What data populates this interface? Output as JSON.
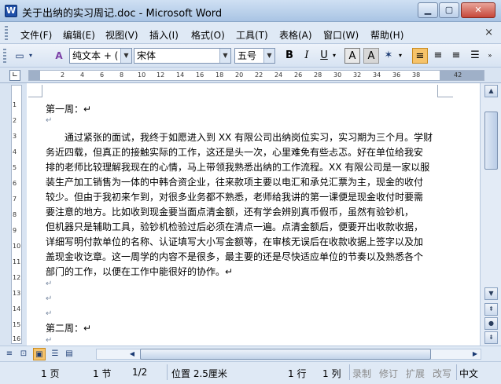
{
  "window": {
    "title": "关于出纳的实习周记.doc - Microsoft Word",
    "minimize": "▁",
    "maximize": "▢",
    "close": "✕"
  },
  "menu": {
    "items": [
      "文件(F)",
      "编辑(E)",
      "视图(V)",
      "插入(I)",
      "格式(O)",
      "工具(T)",
      "表格(A)",
      "窗口(W)",
      "帮助(H)"
    ],
    "close_doc": "×"
  },
  "toolbar": {
    "style_value": "纯文本 + (",
    "font_value": "宋体",
    "size_value": "五号",
    "bold": "B",
    "italic": "I",
    "underline": "U",
    "highlight": "A",
    "charborder": "A"
  },
  "ruler": {
    "ticks": [
      "2",
      "4",
      "6",
      "8",
      "10",
      "12",
      "14",
      "16",
      "18",
      "20",
      "22",
      "24",
      "26",
      "28",
      "30",
      "32",
      "34",
      "36",
      "38",
      "42"
    ],
    "vticks": [
      "1",
      "2",
      "3",
      "4",
      "5",
      "6",
      "7",
      "8",
      "9",
      "10",
      "11",
      "12",
      "13",
      "14",
      "15",
      "16"
    ]
  },
  "document": {
    "lines": [
      "第一周：↵",
      "↵",
      "　　通过紧张的面试，我终于如愿进入到 XX 有限公司出纳岗位实习，实习期为三个月。学财",
      "务近四载，但真正的接触实际的工作，这还是头一次，心里难免有些忐忑。好在单位给我安",
      "排的老师比较理解我现在的心情，马上带领我熟悉出纳的工作流程。XX 有限公司是一家以服",
      "装生产加工销售为一体的中韩合资企业，往来款项主要以电汇和承兑汇票为主，现金的收付",
      "较少。但由于我初来乍到，对很多业务都不熟悉，老师给我讲的第一课便是现金收付时要需",
      "要注意的地方。比如收到现金要当面点清金额，还有学会辨别真币假币，虽然有验钞机，",
      "但机器只是辅助工具，验钞机检验过后必须在清点一遍。点清金额后，便要开出收款收据，",
      "详细写明付款单位的名称、认证填写大小写金额等，在审核无误后在收款收据上签字以及加",
      "盖现金收讫章。这一周学的内容不是很多，最主要的还是尽快适应单位的节奏以及熟悉各个",
      "部门的工作，以便在工作中能很好的协作。↵",
      "↵",
      "↵",
      "↵",
      "第二周：↵",
      "↵"
    ]
  },
  "status": {
    "page": "1 页",
    "section": "1 节",
    "pages": "1/2",
    "position": "位置 2.5厘米",
    "line": "1 行",
    "column": "1 列",
    "rec": "录制",
    "trk": "修订",
    "ext": "扩展",
    "ovr": "改写",
    "language": "中文"
  },
  "icons": {
    "app": "word-app-icon",
    "style_pane": "styles-and-formatting-icon",
    "font_color": "font-color-icon",
    "align_left": "align-left-icon",
    "align_center": "align-center-icon",
    "align_right": "align-right-icon",
    "justify": "justify-icon"
  },
  "colors": {
    "accent": "#f6c36a",
    "chrome": "#dfe9f5",
    "titlebar": "#a9c4e4"
  }
}
